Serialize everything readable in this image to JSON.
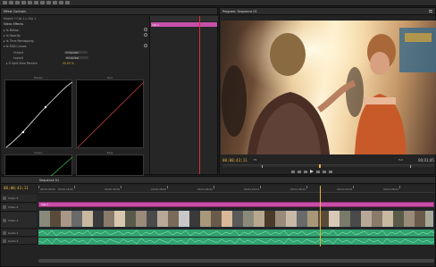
{
  "toolbar": {
    "icon_count": 14
  },
  "effect_controls": {
    "tab_label": "Effect Controls",
    "clip_path": "Master * Clip 1  ▸  Clip 1",
    "section_title": "Video Effects",
    "rows": [
      {
        "label": "▸ fx  Motion"
      },
      {
        "label": "▸ fx  Opacity"
      },
      {
        "label": "▸ fx  Time Remapping"
      },
      {
        "label": "▾ fx  RGB Curves"
      },
      {
        "label": "Output",
        "value": "Composite"
      },
      {
        "label": "Layout",
        "value": "Horizontal"
      },
      {
        "label": "▸ Ö  Split View Percent",
        "value": "50.00 %"
      }
    ],
    "graph_labels": [
      "Master",
      "Red",
      "Green",
      "Blue"
    ],
    "mini_timeline_label": "Clip 1"
  },
  "program_monitor": {
    "tab_label": "Program: Sequence 01",
    "timecode_left": "00;00;43;11",
    "timecode_right": "00;01;45",
    "fit_label": "Fit",
    "quality_label": "Full"
  },
  "timeline": {
    "tab_label": "Sequence 01",
    "timecode": "00;00;43;11",
    "ruler_labels": [
      "00;00;00;00",
      "00;00;16;00",
      "00;00;32;00",
      "00;00;48;00",
      "00;01;04;02",
      "00;01;20;02",
      "00;01;36;02",
      "00;01;52;04",
      "00;02;08;04"
    ],
    "tracks": [
      {
        "label": "V3",
        "name": "Video 3"
      },
      {
        "label": "V2",
        "name": "Video 2"
      },
      {
        "label": "V1",
        "name": "Video 1"
      },
      {
        "label": "A1",
        "name": "Audio 1"
      },
      {
        "label": "A2",
        "name": "Audio 2"
      }
    ],
    "v2_clip_label": "Clip 1"
  },
  "colors": {
    "accent": "#e8b23a",
    "playhead": "#d23232",
    "clip_pink": "#c84fa8",
    "clip_blue": "#4a7aa8",
    "audio_green": "#2fa370"
  }
}
